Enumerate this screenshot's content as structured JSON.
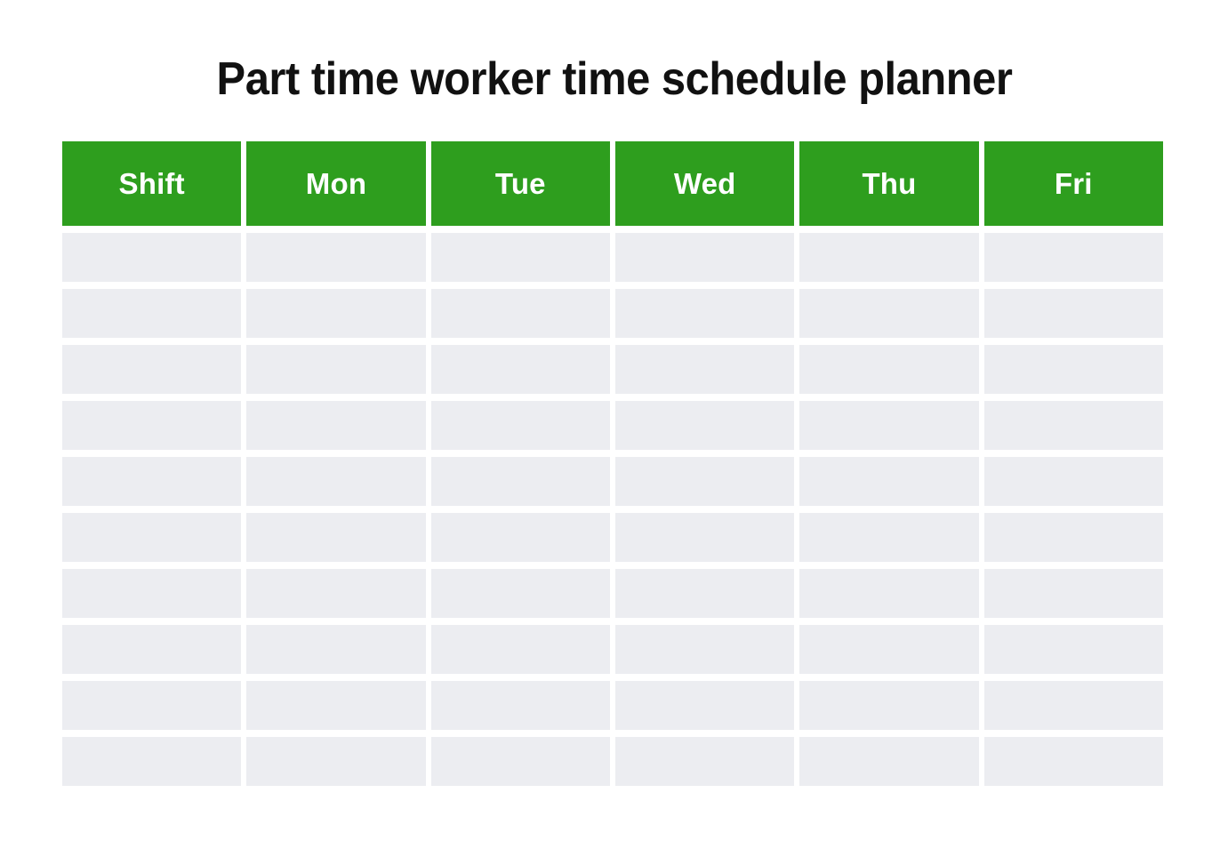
{
  "document": {
    "title": "Part time worker time schedule planner",
    "background_color": "#ffffff",
    "title_color": "#111111"
  },
  "table": {
    "header_background": "#2e9e1e",
    "header_text_color": "#ffffff",
    "cell_background": "#ecedf1",
    "column_count": 6,
    "row_count": 10,
    "columns": [
      {
        "key": "shift",
        "label": "Shift"
      },
      {
        "key": "mon",
        "label": "Mon"
      },
      {
        "key": "tue",
        "label": "Tue"
      },
      {
        "key": "wed",
        "label": "Wed"
      },
      {
        "key": "thu",
        "label": "Thu"
      },
      {
        "key": "fri",
        "label": "Fri"
      }
    ],
    "rows": [
      {
        "shift": "",
        "mon": "",
        "tue": "",
        "wed": "",
        "thu": "",
        "fri": ""
      },
      {
        "shift": "",
        "mon": "",
        "tue": "",
        "wed": "",
        "thu": "",
        "fri": ""
      },
      {
        "shift": "",
        "mon": "",
        "tue": "",
        "wed": "",
        "thu": "",
        "fri": ""
      },
      {
        "shift": "",
        "mon": "",
        "tue": "",
        "wed": "",
        "thu": "",
        "fri": ""
      },
      {
        "shift": "",
        "mon": "",
        "tue": "",
        "wed": "",
        "thu": "",
        "fri": ""
      },
      {
        "shift": "",
        "mon": "",
        "tue": "",
        "wed": "",
        "thu": "",
        "fri": ""
      },
      {
        "shift": "",
        "mon": "",
        "tue": "",
        "wed": "",
        "thu": "",
        "fri": ""
      },
      {
        "shift": "",
        "mon": "",
        "tue": "",
        "wed": "",
        "thu": "",
        "fri": ""
      },
      {
        "shift": "",
        "mon": "",
        "tue": "",
        "wed": "",
        "thu": "",
        "fri": ""
      },
      {
        "shift": "",
        "mon": "",
        "tue": "",
        "wed": "",
        "thu": "",
        "fri": ""
      }
    ]
  }
}
